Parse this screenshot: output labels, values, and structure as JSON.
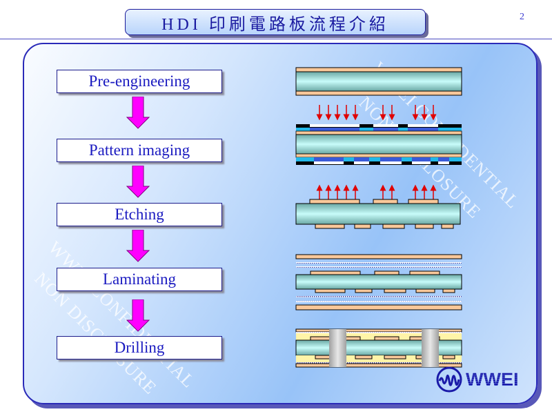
{
  "title": "HDI 印刷電路板流程介紹",
  "page_number": "2",
  "steps": [
    {
      "label": "Pre-engineering"
    },
    {
      "label": "Pattern imaging"
    },
    {
      "label": "Etching"
    },
    {
      "label": "Laminating"
    },
    {
      "label": "Drilling"
    }
  ],
  "watermarks": {
    "right_line1": "WWEI CONFIDENTIAL",
    "right_line2": "NON DISCLOSURE",
    "left_line1": "WWEI CONFIDENTIAL",
    "left_line2": "NON DISCLOSURE"
  },
  "logo": {
    "text": "WWEI"
  },
  "colors": {
    "title_text": "#1a1aa0",
    "step_text": "#1a1ac0",
    "arrow": "#ff00ff",
    "copper": "#f9c89a",
    "core": "#b8f0ee",
    "uv_arrow": "#e00000",
    "prepreg": "#fff4a8",
    "via": "#c8c8c8"
  }
}
